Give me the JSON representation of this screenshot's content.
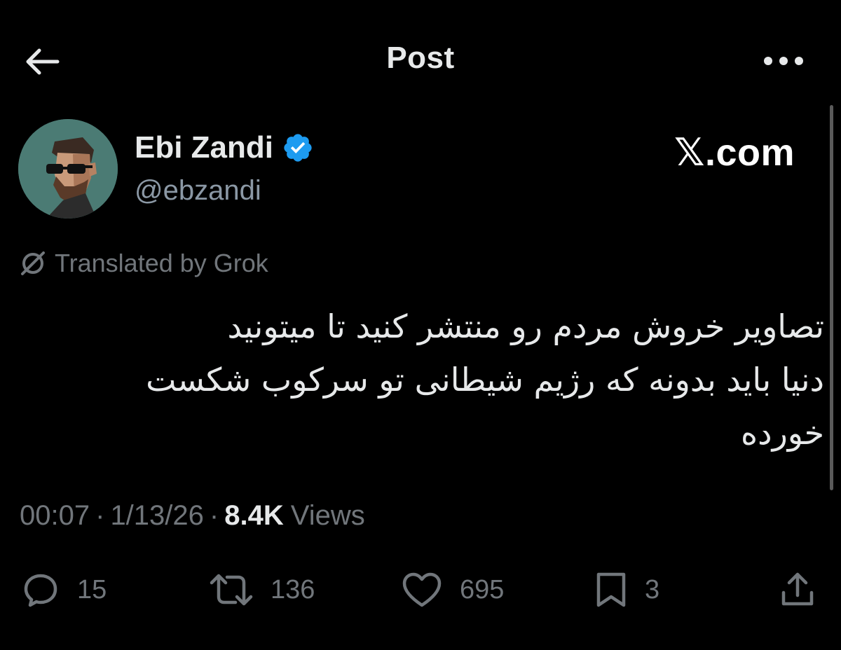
{
  "header": {
    "title": "Post",
    "back_icon": "arrow-left-icon",
    "more_icon": "more-horizontal-icon"
  },
  "author": {
    "display_name": "Ebi Zandi",
    "handle": "@ebzandi",
    "verified": true,
    "avatar_bg": "#4b7b74"
  },
  "watermark": {
    "glyph": "𝕏",
    "text": ".com"
  },
  "translation": {
    "label": "Translated by Grok"
  },
  "post": {
    "lines": [
      "تصاویر خروش مردم رو منتشر کنید تا میتونید",
      "دنیا باید بدونه که رژیم شیطانی تو سرکوب شکست",
      "خورده"
    ]
  },
  "meta": {
    "time": "00:07",
    "date": "1/13/26",
    "views_count": "8.4K",
    "views_label": "Views"
  },
  "actions": {
    "replies": "15",
    "reposts": "136",
    "likes": "695",
    "bookmarks": "3"
  },
  "colors": {
    "background": "#000000",
    "text_primary": "#e7e9ea",
    "text_secondary": "#71767b",
    "verified_blue": "#1d9bf0"
  }
}
